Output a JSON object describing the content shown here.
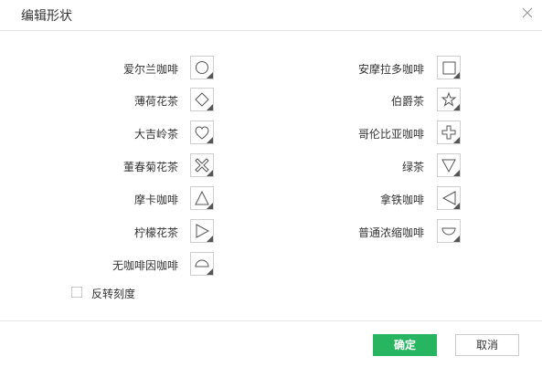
{
  "dialog": {
    "title": "编辑形状"
  },
  "left_items": [
    {
      "label": "爱尔兰咖啡",
      "shape": "circle-icon"
    },
    {
      "label": "薄荷花茶",
      "shape": "diamond-icon"
    },
    {
      "label": "大吉岭茶",
      "shape": "heart-icon"
    },
    {
      "label": "董春菊花茶",
      "shape": "x-cross-icon"
    },
    {
      "label": "摩卡咖啡",
      "shape": "triangle-up-icon"
    },
    {
      "label": "柠檬花茶",
      "shape": "triangle-right-icon"
    },
    {
      "label": "无咖啡因咖啡",
      "shape": "semicircle-top-icon"
    }
  ],
  "right_items": [
    {
      "label": "安摩拉多咖啡",
      "shape": "square-icon"
    },
    {
      "label": "伯爵茶",
      "shape": "star-icon"
    },
    {
      "label": "哥伦比亚咖啡",
      "shape": "plus-icon"
    },
    {
      "label": "绿茶",
      "shape": "triangle-down-icon"
    },
    {
      "label": "拿铁咖啡",
      "shape": "triangle-left-icon"
    },
    {
      "label": "普通浓缩咖啡",
      "shape": "semicircle-bottom-icon"
    }
  ],
  "options": {
    "reverse_scale_label": "反转刻度",
    "reverse_scale_checked": false
  },
  "buttons": {
    "ok_label": "确定",
    "cancel_label": "取消"
  },
  "colors": {
    "primary": "#28b561",
    "border": "#cfcfcf",
    "corner_marker": "#555555"
  }
}
